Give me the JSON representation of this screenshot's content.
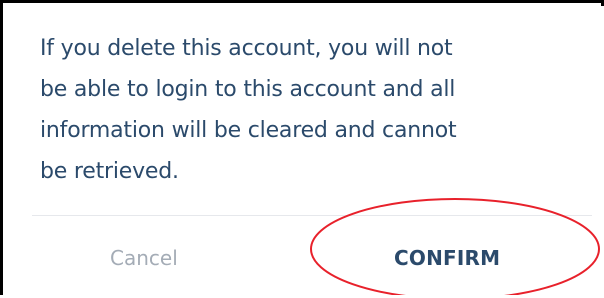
{
  "dialog": {
    "message_lines": [
      "If you delete this account, you will not",
      "be able to login to this account and all",
      "information will be cleared and cannot",
      "be retrieved."
    ],
    "cancel_label": "Cancel",
    "confirm_label": "CONFIRM"
  },
  "colors": {
    "message_text": "#2b4a6b",
    "cancel_text": "#a4acb6",
    "confirm_text": "#2b4a6b",
    "annotation": "#e8212b"
  }
}
